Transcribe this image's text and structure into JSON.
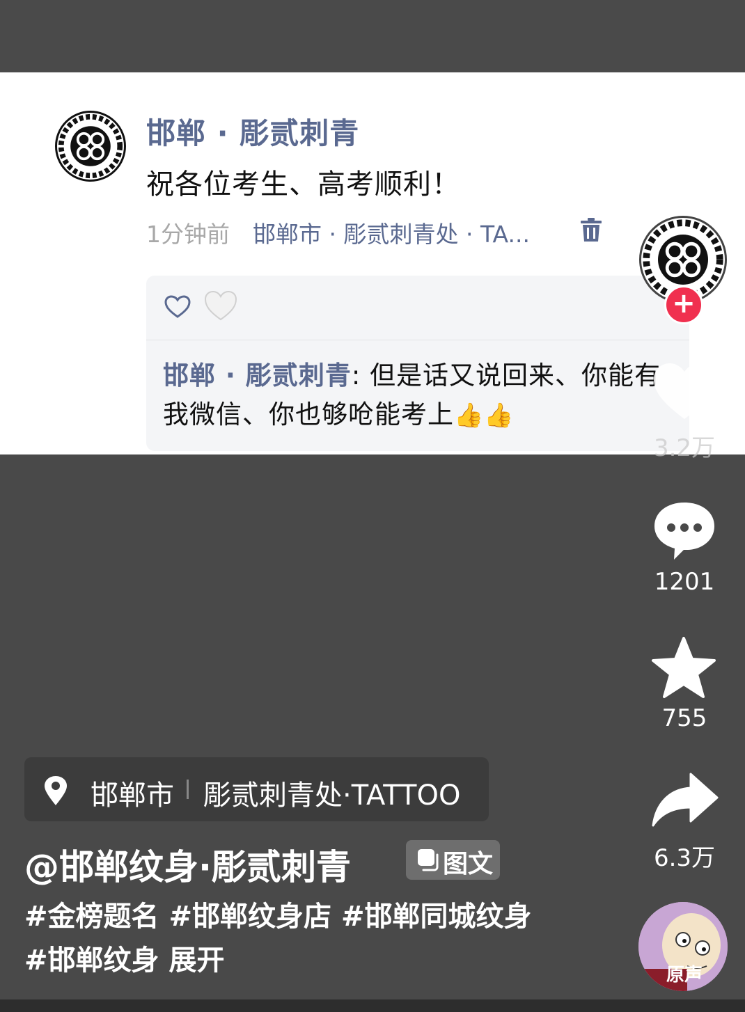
{
  "card": {
    "author": "邯郸 · 彫贰刺青",
    "text": "祝各位考生、高考顺利！",
    "time": "1分钟前",
    "location": "邯郸市 · 彫贰刺青处 · TA...",
    "reply": {
      "author": "邯郸 · 彫贰刺青",
      "text": ": 但是话又说回来、你能有我微信、你也够呛能考上",
      "emoji": "👍👍"
    }
  },
  "rail": {
    "likes": "3.2万",
    "comments": "1201",
    "favorites": "755",
    "shares": "6.3万",
    "follow_symbol": "+",
    "music_label": "原声"
  },
  "location_chip": {
    "city": "邯郸市",
    "shop": "彫贰刺青处·TATTOO"
  },
  "post": {
    "username": "@邯郸纹身·彫贰刺青",
    "badge": "图文",
    "tags": [
      "#金榜题名",
      "#邯郸纹身店",
      "#邯郸同城纹身",
      "#邯郸纹身"
    ],
    "expand": "展开"
  },
  "icons": {
    "avatar": "knot-logo-icon",
    "trash": "trash-icon",
    "heart_outline": "heart-outline-icon",
    "heart_white": "heart-icon",
    "comment": "comment-bubble-icon",
    "favorite": "star-icon",
    "share": "share-arrow-icon",
    "location": "location-pin-icon",
    "gallery": "gallery-icon"
  },
  "colors": {
    "accent_blue": "#5a6990",
    "follow_red": "#f0304f",
    "background": "#494949"
  }
}
